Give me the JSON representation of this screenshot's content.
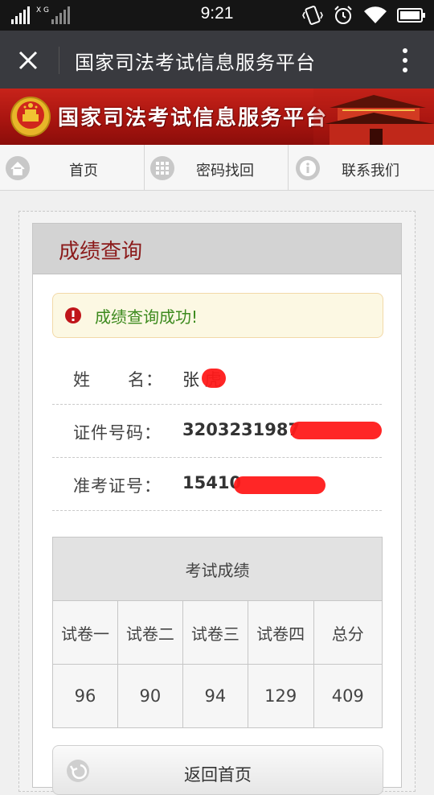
{
  "status_bar": {
    "time": "9:21",
    "network_label": "X G"
  },
  "app_bar": {
    "title": "国家司法考试信息服务平台"
  },
  "banner": {
    "title": "国家司法考试信息服务平台"
  },
  "nav": {
    "items": [
      {
        "label": "首页",
        "icon": "home-icon"
      },
      {
        "label": "密码找回",
        "icon": "grid-icon"
      },
      {
        "label": "联系我们",
        "icon": "info-icon"
      }
    ]
  },
  "panel": {
    "title": "成绩查询",
    "alert": "成绩查询成功!",
    "fields": [
      {
        "label": "姓      名：",
        "value": "张 虎"
      },
      {
        "label": "证件号码：",
        "value": "3203231987"
      },
      {
        "label": "准考证号：",
        "value": "15410"
      }
    ],
    "table": {
      "caption": "考试成绩",
      "headers": [
        "试卷一",
        "试卷二",
        "试卷三",
        "试卷四",
        "总分"
      ],
      "values": [
        "96",
        "90",
        "94",
        "129",
        "409"
      ]
    },
    "back_button": "返回首页"
  },
  "colors": {
    "banner_red": "#a91510",
    "panel_title": "#8b1a1a",
    "alert_green": "#3c8a1e",
    "app_bar": "#393a3f"
  }
}
